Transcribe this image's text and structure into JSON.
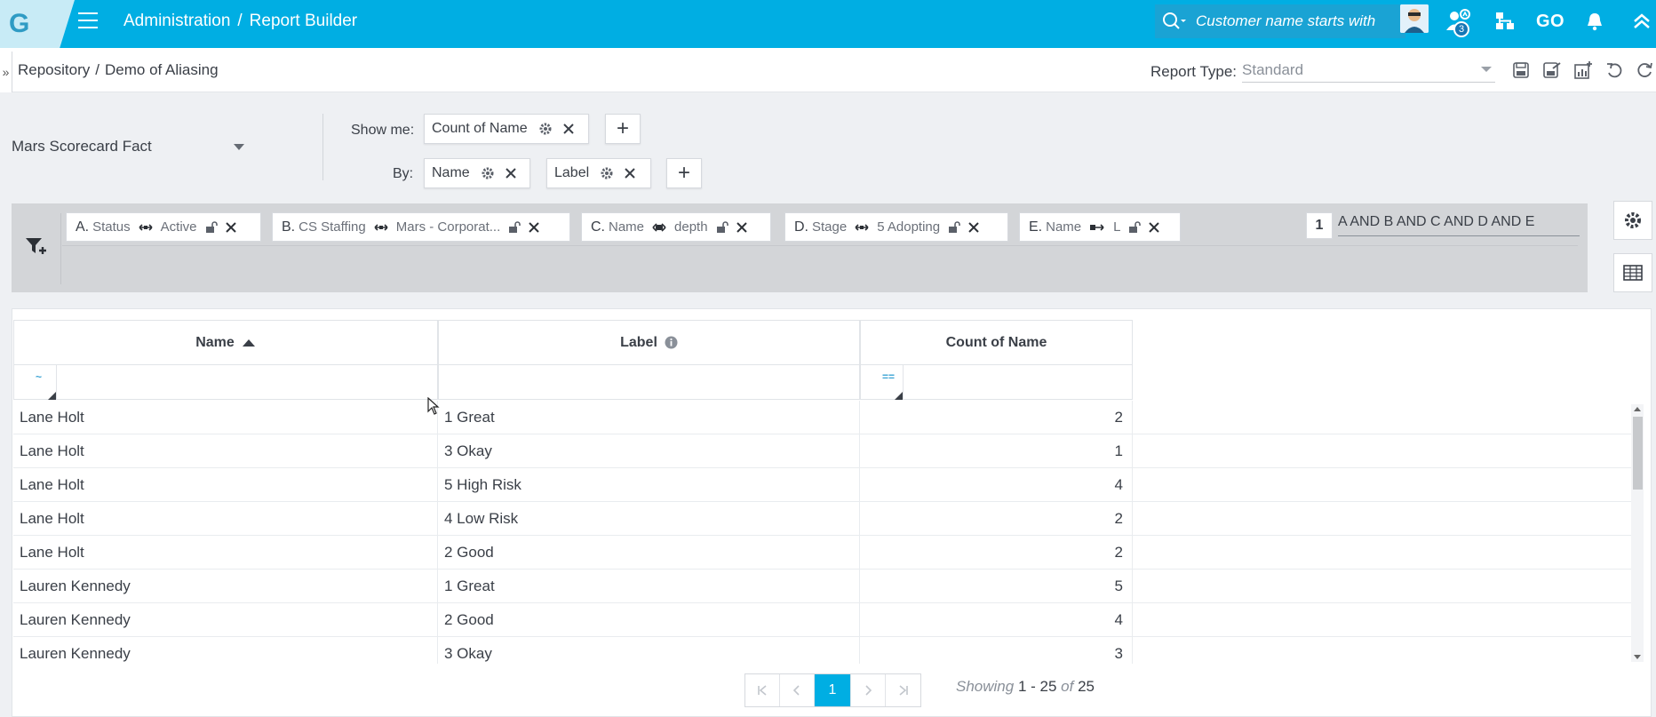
{
  "topbar": {
    "logo": "G",
    "breadcrumb": [
      "Administration",
      "/",
      "Report Builder"
    ],
    "search_placeholder": "Customer name starts with",
    "notification_count": "3",
    "go_label": "GO"
  },
  "subbar": {
    "collapse_glyph": "»",
    "breadcrumb": [
      "Repository",
      "/",
      "Demo of Aliasing"
    ],
    "report_type_label": "Report Type:",
    "report_type_value": "Standard"
  },
  "builder": {
    "object": "Mars Scorecard Fact",
    "show_me_label": "Show me:",
    "by_label": "By:",
    "show_me_chips": [
      "Count of Name"
    ],
    "by_chips": [
      "Name",
      "Label"
    ],
    "plus": "+"
  },
  "filters": [
    {
      "letter": "A.",
      "field": "Status",
      "value": "Active"
    },
    {
      "letter": "B.",
      "field": "CS Staffing",
      "value": "Mars - Corporat..."
    },
    {
      "letter": "C.",
      "field": "Name",
      "value": "depth"
    },
    {
      "letter": "D.",
      "field": "Stage",
      "value": "5 Adopting"
    },
    {
      "letter": "E.",
      "field": "Name",
      "value": "L"
    }
  ],
  "logic": {
    "number": "1",
    "expression": "A AND B AND C AND D AND E"
  },
  "table": {
    "columns": [
      "Name",
      "Label",
      "Count of Name"
    ],
    "filter_glyphs": [
      "~",
      "",
      "=="
    ],
    "rows": [
      [
        "Lane Holt",
        "1 Great",
        "2"
      ],
      [
        "Lane Holt",
        "3 Okay",
        "1"
      ],
      [
        "Lane Holt",
        "5 High Risk",
        "4"
      ],
      [
        "Lane Holt",
        "4 Low Risk",
        "2"
      ],
      [
        "Lane Holt",
        "2 Good",
        "2"
      ],
      [
        "Lauren Kennedy",
        "1 Great",
        "5"
      ],
      [
        "Lauren Kennedy",
        "2 Good",
        "4"
      ],
      [
        "Lauren Kennedy",
        "3 Okay",
        "3"
      ]
    ]
  },
  "pagination": {
    "current_page": "1",
    "showing_label": "Showing",
    "range": "1 - 25",
    "of_label": "of",
    "total": "25"
  },
  "colors": {
    "brand": "#00aee3",
    "filter_bar": "#d3d5d8"
  }
}
